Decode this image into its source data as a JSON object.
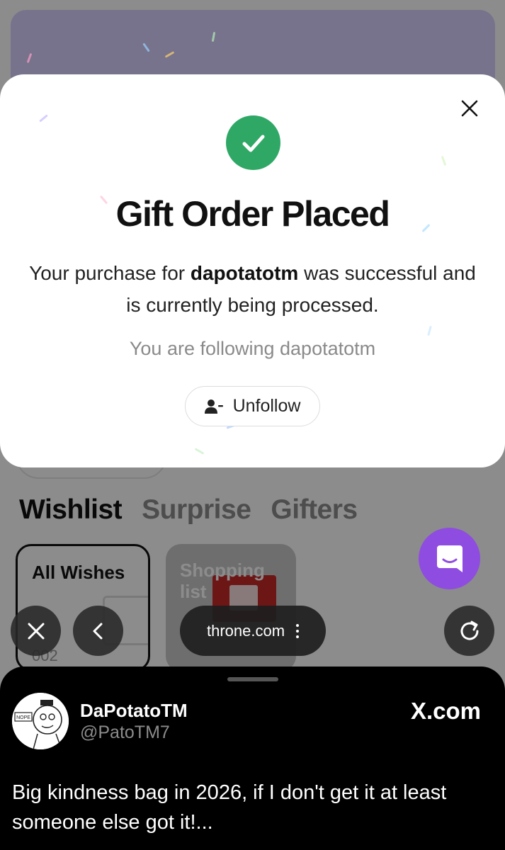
{
  "background": {
    "tabs": [
      "Wishlist",
      "Surprise",
      "Gifters"
    ],
    "cards": {
      "all_wishes": {
        "title": "All Wishes",
        "count": "002"
      },
      "shopping": {
        "title": "Shopping list"
      }
    }
  },
  "modal": {
    "title": "Gift Order Placed",
    "message_pre": "Your purchase for ",
    "message_user": "dapotatotm",
    "message_post": " was successful and is currently being processed.",
    "follow_status": "You are following dapotatotm",
    "unfollow_label": "Unfollow",
    "close_icon": "close-icon",
    "success_icon": "check-circle-icon",
    "success_color": "#2fa866"
  },
  "browser": {
    "url": "throne.com",
    "close_icon": "close-icon",
    "back_icon": "chevron-left-icon",
    "reload_icon": "reload-icon",
    "more_icon": "more-vertical-icon"
  },
  "chat": {
    "icon": "chat-icon",
    "color": "#8f4ce0"
  },
  "tweet": {
    "display_name": "DaPotatoTM",
    "username": "@PatoTM7",
    "source": "X.com",
    "avatar_text": "NOPE",
    "text": "Big kindness bag in 2026, if I don't get it at least someone else got it!..."
  }
}
